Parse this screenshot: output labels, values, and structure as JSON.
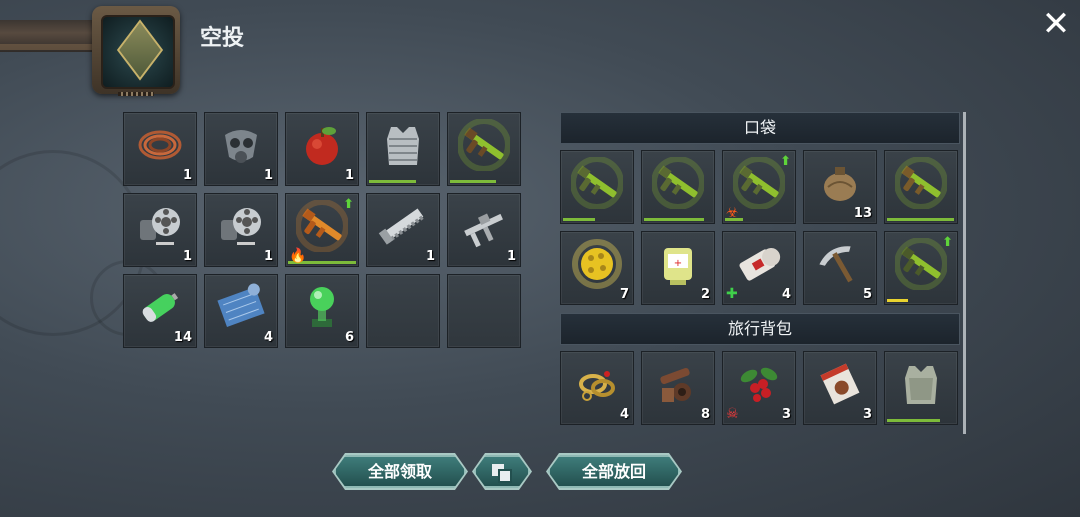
{
  "header": {
    "title": "空投",
    "close_icon": "close-x-icon"
  },
  "airdrop_grid": [
    {
      "icon": "wire-coil-icon",
      "qty": "1"
    },
    {
      "icon": "gas-mask-icon",
      "qty": "1"
    },
    {
      "icon": "apple-icon",
      "qty": "1"
    },
    {
      "icon": "vest-armor-icon",
      "qty": "",
      "durability": 0.67
    },
    {
      "icon": "shotgun-icon",
      "qty": "",
      "durability": 0.65
    },
    {
      "icon": "gas-mask-filter-icon",
      "qty": "1"
    },
    {
      "icon": "gas-mask-filter-icon",
      "qty": "1"
    },
    {
      "icon": "ak-rifle-icon",
      "qty": "",
      "durability": 0.97,
      "upgrade": true,
      "tag": "fire"
    },
    {
      "icon": "hand-saw-icon",
      "qty": "1"
    },
    {
      "icon": "caliper-icon",
      "qty": "1"
    },
    {
      "icon": "battery-icon",
      "qty": "14"
    },
    {
      "icon": "blueprint-icon",
      "qty": "4"
    },
    {
      "icon": "green-orb-icon",
      "qty": "6"
    },
    {
      "empty": true
    },
    {
      "empty": true
    }
  ],
  "pocket": {
    "title": "口袋",
    "items": [
      {
        "icon": "assault-rifle-icon",
        "qty": "",
        "durability": 0.45
      },
      {
        "icon": "assault-rifle-icon",
        "qty": "",
        "durability": 0.85
      },
      {
        "icon": "assault-rifle-icon",
        "qty": "",
        "durability": 0.25,
        "upgrade": true,
        "tag": "biohazard"
      },
      {
        "icon": "canteen-icon",
        "qty": "13"
      },
      {
        "icon": "crossbow-icon",
        "qty": "",
        "durability": 0.95
      },
      {
        "icon": "spore-ball-icon",
        "qty": "7"
      },
      {
        "icon": "blood-bag-icon",
        "qty": "2"
      },
      {
        "icon": "bandage-icon",
        "qty": "4",
        "tag": "medical"
      },
      {
        "icon": "pickaxe-icon",
        "qty": "5"
      },
      {
        "icon": "sniper-rifle-icon",
        "qty": "",
        "durability": 0.3,
        "durability_color": "yellow",
        "upgrade": true
      }
    ]
  },
  "backpack": {
    "title": "旅行背包",
    "items": [
      {
        "icon": "jewelry-icon",
        "qty": "4"
      },
      {
        "icon": "scrap-parts-icon",
        "qty": "8"
      },
      {
        "icon": "berries-icon",
        "qty": "3",
        "tag": "skull"
      },
      {
        "icon": "seed-packet-icon",
        "qty": "3"
      },
      {
        "icon": "body-armor-icon",
        "qty": "",
        "durability": 0.75
      }
    ]
  },
  "buttons": {
    "take_all": "全部领取",
    "sort_icon": "stack-sort-icon",
    "return_all": "全部放回"
  },
  "colors": {
    "accent_teal": "#2f6665",
    "durability_green": "#7dbb3a",
    "durability_yellow": "#e9d32f",
    "upgrade_green": "#5fd43a"
  }
}
